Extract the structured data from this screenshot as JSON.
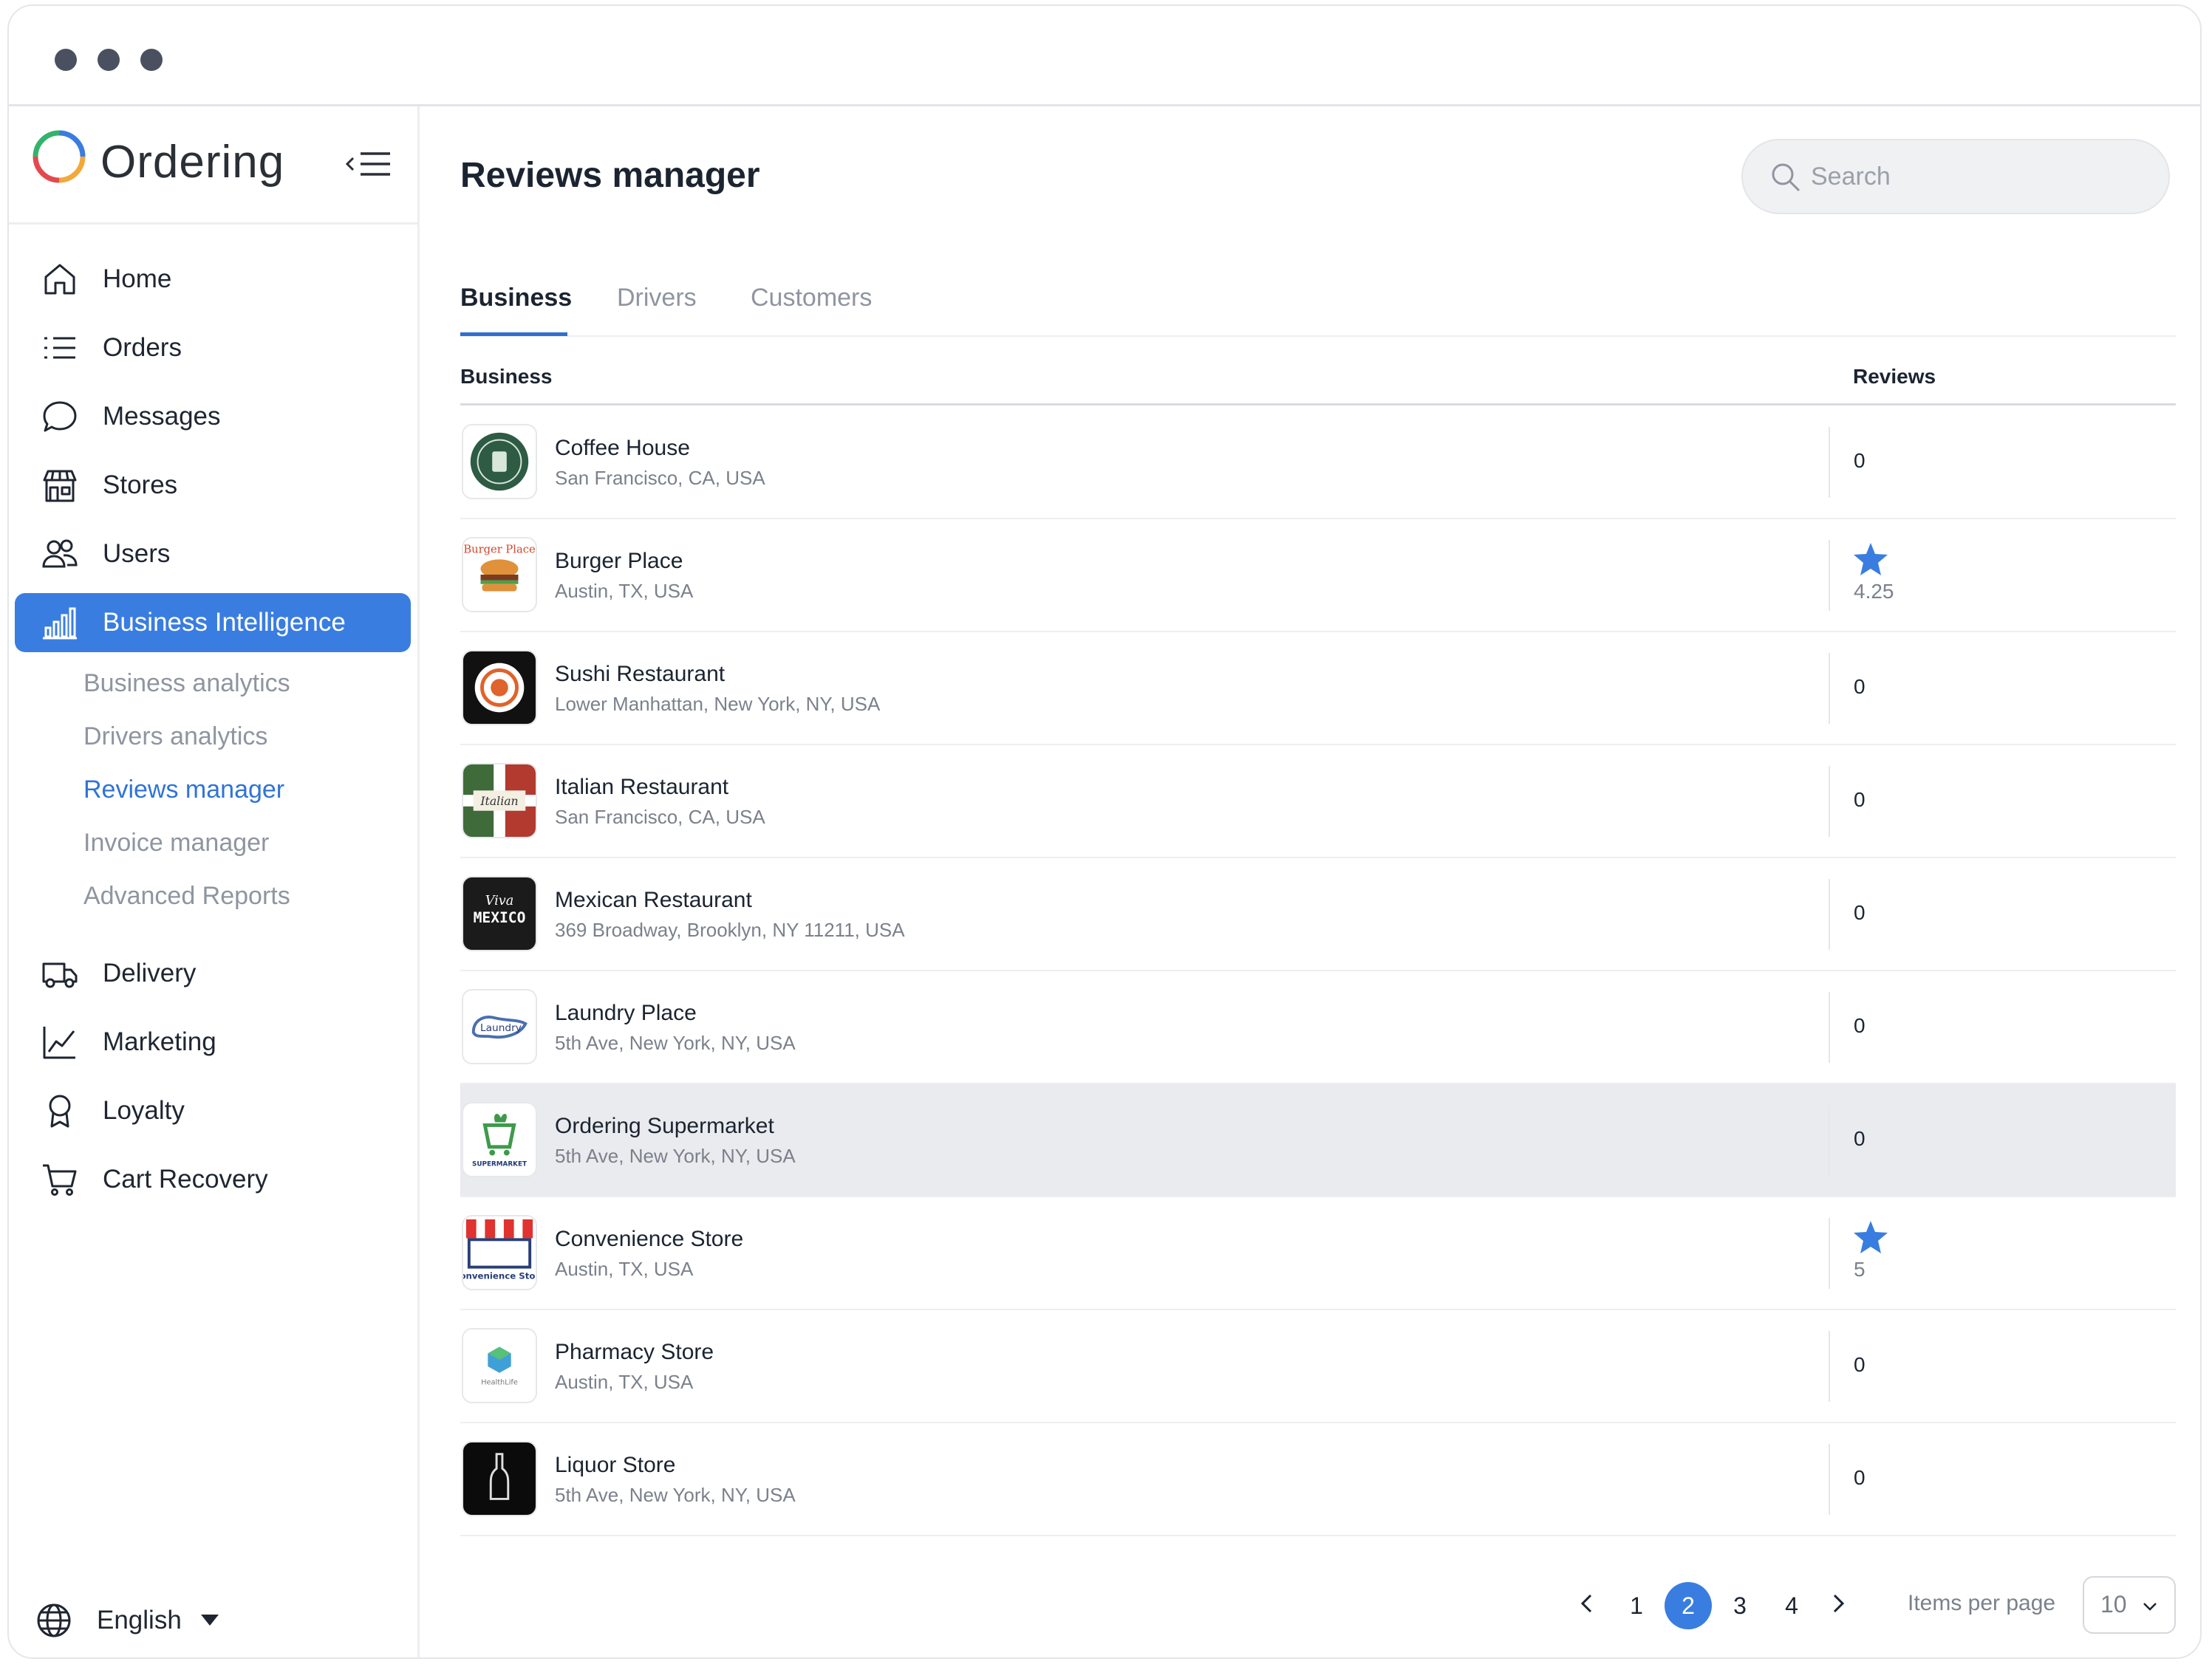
{
  "app": {
    "brand": "Ordering"
  },
  "sidebar": {
    "items": [
      {
        "label": "Home",
        "icon": "home-icon"
      },
      {
        "label": "Orders",
        "icon": "list-icon"
      },
      {
        "label": "Messages",
        "icon": "chat-icon"
      },
      {
        "label": "Stores",
        "icon": "store-icon"
      },
      {
        "label": "Users",
        "icon": "users-icon"
      },
      {
        "label": "Business Intelligence",
        "icon": "bar-chart-icon",
        "active": true
      },
      {
        "label": "Delivery",
        "icon": "truck-icon"
      },
      {
        "label": "Marketing",
        "icon": "trend-icon"
      },
      {
        "label": "Loyalty",
        "icon": "award-icon"
      },
      {
        "label": "Cart Recovery",
        "icon": "cart-icon"
      }
    ],
    "subitems": [
      {
        "label": "Business analytics"
      },
      {
        "label": "Drivers analytics"
      },
      {
        "label": "Reviews manager",
        "active": true
      },
      {
        "label": "Invoice manager"
      },
      {
        "label": "Advanced Reports"
      }
    ],
    "language": "English"
  },
  "header": {
    "title": "Reviews manager",
    "search_placeholder": "Search"
  },
  "tabs": [
    {
      "label": "Business",
      "active": true
    },
    {
      "label": "Drivers"
    },
    {
      "label": "Customers"
    }
  ],
  "table": {
    "columns": [
      "Business",
      "Reviews"
    ],
    "rows": [
      {
        "name": "Coffee House",
        "address": "San Francisco, CA, USA",
        "reviews": "0"
      },
      {
        "name": "Burger Place",
        "address": "Austin, TX, USA",
        "rating": "4.25"
      },
      {
        "name": "Sushi Restaurant",
        "address": "Lower Manhattan, New York, NY, USA",
        "reviews": "0"
      },
      {
        "name": "Italian Restaurant",
        "address": "San Francisco, CA, USA",
        "reviews": "0"
      },
      {
        "name": "Mexican Restaurant",
        "address": "369 Broadway, Brooklyn, NY 11211, USA",
        "reviews": "0"
      },
      {
        "name": "Laundry Place",
        "address": "5th Ave, New York, NY, USA",
        "reviews": "0"
      },
      {
        "name": "Ordering Supermarket",
        "address": "5th Ave, New York, NY, USA",
        "reviews": "0",
        "highlighted": true
      },
      {
        "name": "Convenience Store",
        "address": "Austin, TX, USA",
        "rating": "5"
      },
      {
        "name": "Pharmacy Store",
        "address": "Austin, TX, USA",
        "reviews": "0"
      },
      {
        "name": "Liquor Store",
        "address": "5th Ave, New York, NY, USA",
        "reviews": "0"
      }
    ],
    "logo_text": {
      "burger": "Burger Place",
      "italian": "Italian",
      "mexican_top": "Viva",
      "mexican_bottom": "MEXICO",
      "laundry": "Laundry",
      "supermarket": "SUPERMARKET",
      "convenience": "Convenience Store",
      "pharmacy": "HealthLife"
    }
  },
  "pagination": {
    "pages": [
      "1",
      "2",
      "3",
      "4"
    ],
    "current": "2",
    "items_per_page_label": "Items per page",
    "items_per_page": "10"
  },
  "colors": {
    "accent": "#3a7de0",
    "star": "#3a7de0",
    "row_highlight": "#e9ebef"
  }
}
